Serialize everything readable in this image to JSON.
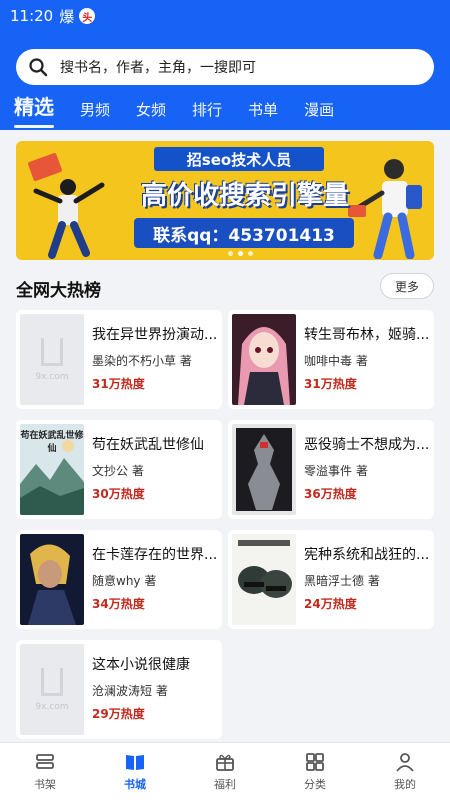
{
  "status": {
    "time": "11:20",
    "badge": "爆",
    "notif": "头"
  },
  "search": {
    "placeholder": "搜书名，作者，主角，一搜即可"
  },
  "tabs": [
    "精选",
    "男频",
    "女频",
    "排行",
    "书单",
    "漫画"
  ],
  "banner": {
    "title": "招seo技术人员",
    "main": "高价收搜索引擎量",
    "contact": "联系qq：453701413"
  },
  "section": {
    "title": "全网大热榜",
    "more": "更多"
  },
  "books": [
    {
      "title": "我在异世界扮演动...",
      "author": "墨染的不朽小草 著",
      "heat": "31万热度",
      "cover": "placeholder",
      "cover_label": "9x.com"
    },
    {
      "title": "转生哥布林，姬骑...",
      "author": "咖啡中毒 著",
      "heat": "31万热度",
      "cover": "anime-girl"
    },
    {
      "title": "苟在妖武乱世修仙",
      "author": "文抄公 著",
      "heat": "30万热度",
      "cover": "landscape",
      "cover_text": "苟在妖武乱世修仙"
    },
    {
      "title": "恶役骑士不想成为...",
      "author": "零溢事件 著",
      "heat": "36万热度",
      "cover": "mecha"
    },
    {
      "title": "在卡莲存在的世界...",
      "author": "随意why 著",
      "heat": "34万热度",
      "cover": "dark-character"
    },
    {
      "title": "宪种系统和战狂的...",
      "author": "黑暗浮士德 著",
      "heat": "24万热度",
      "cover": "helmets"
    },
    {
      "title": "这本小说很健康",
      "author": "沧澜波涛短 著",
      "heat": "29万热度",
      "cover": "placeholder",
      "cover_label": "9x.com"
    }
  ],
  "nav": [
    {
      "label": "书架",
      "icon": "bookshelf-icon"
    },
    {
      "label": "书城",
      "icon": "book-open-icon",
      "active": true
    },
    {
      "label": "福利",
      "icon": "gift-icon"
    },
    {
      "label": "分类",
      "icon": "grid-icon"
    },
    {
      "label": "我的",
      "icon": "person-icon"
    }
  ],
  "colors": {
    "primary": "#1663f5",
    "heat": "#c22a1e",
    "banner_bg": "#f4c51d"
  }
}
